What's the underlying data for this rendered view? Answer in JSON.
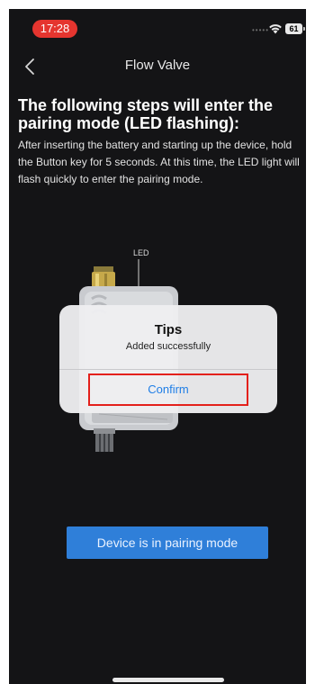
{
  "status_bar": {
    "time": "17:28",
    "battery": "61",
    "time_color": "#e5352f",
    "signal_icon": "signal-dots-icon",
    "wifi_icon": "wifi-icon"
  },
  "nav": {
    "title": "Flow Valve",
    "back_icon": "chevron-left-icon"
  },
  "content": {
    "headline": "The following steps will enter the pairing mode (LED flashing):",
    "instructions": "After inserting the battery and starting up the device, hold the Button key for 5 seconds. At this time, the LED light will flash quickly to enter the pairing mode.",
    "led_label": "LED"
  },
  "dialog": {
    "title": "Tips",
    "message": "Added successfully",
    "confirm_label": "Confirm",
    "highlight_color": "#e3201b"
  },
  "pairing_button": {
    "label": "Device is in pairing mode",
    "color": "#2f7fd9"
  },
  "colors": {
    "background": "#141416",
    "link": "#1f7ee6"
  }
}
